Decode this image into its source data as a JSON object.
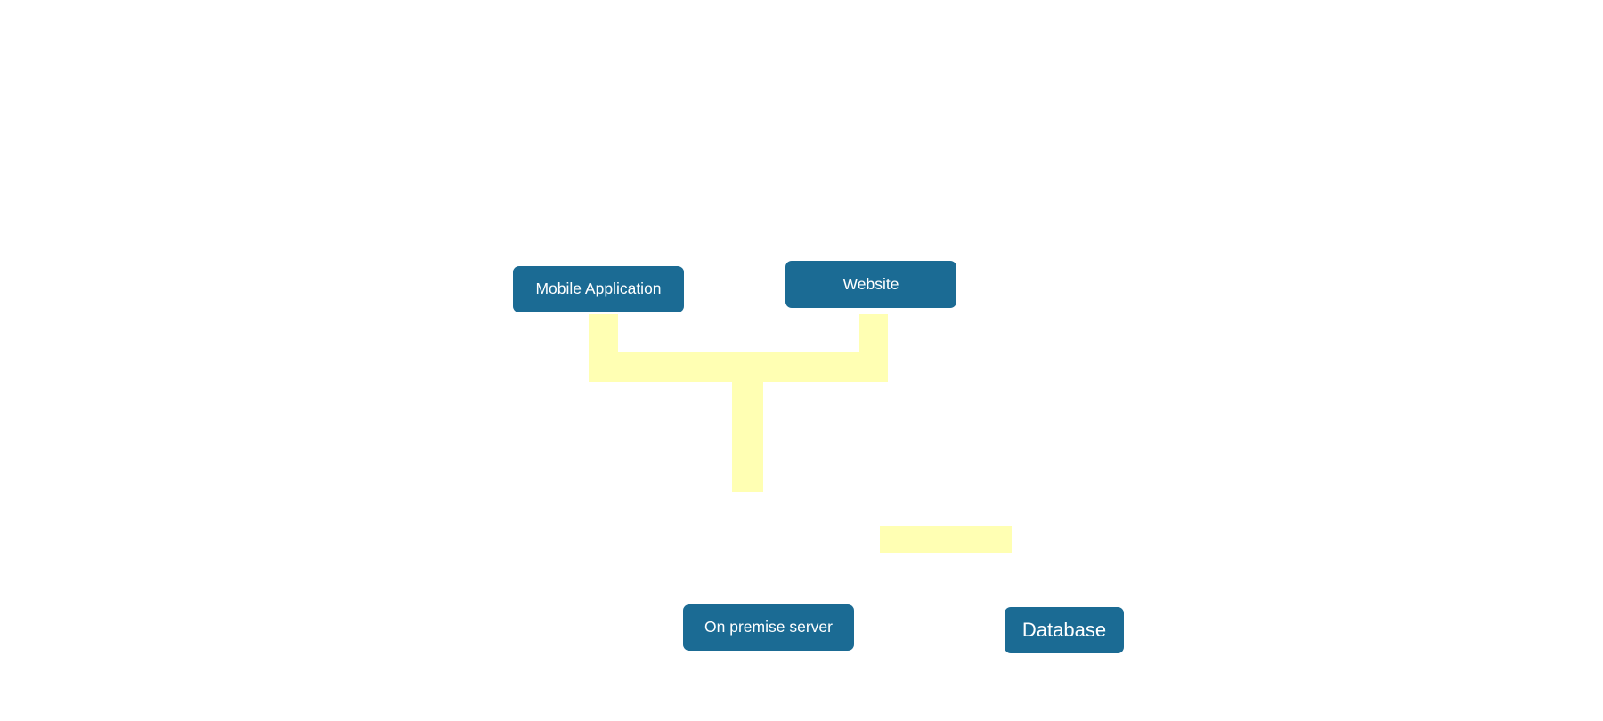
{
  "diagram": {
    "nodes": {
      "mobile_application": "Mobile Application",
      "website": "Website",
      "on_premise_server": "On premise server",
      "database": "Database"
    },
    "colors": {
      "node_fill": "#1b6b94",
      "node_text": "#ffffff",
      "connector": "#ffffb3",
      "background": "#ffffff"
    }
  }
}
